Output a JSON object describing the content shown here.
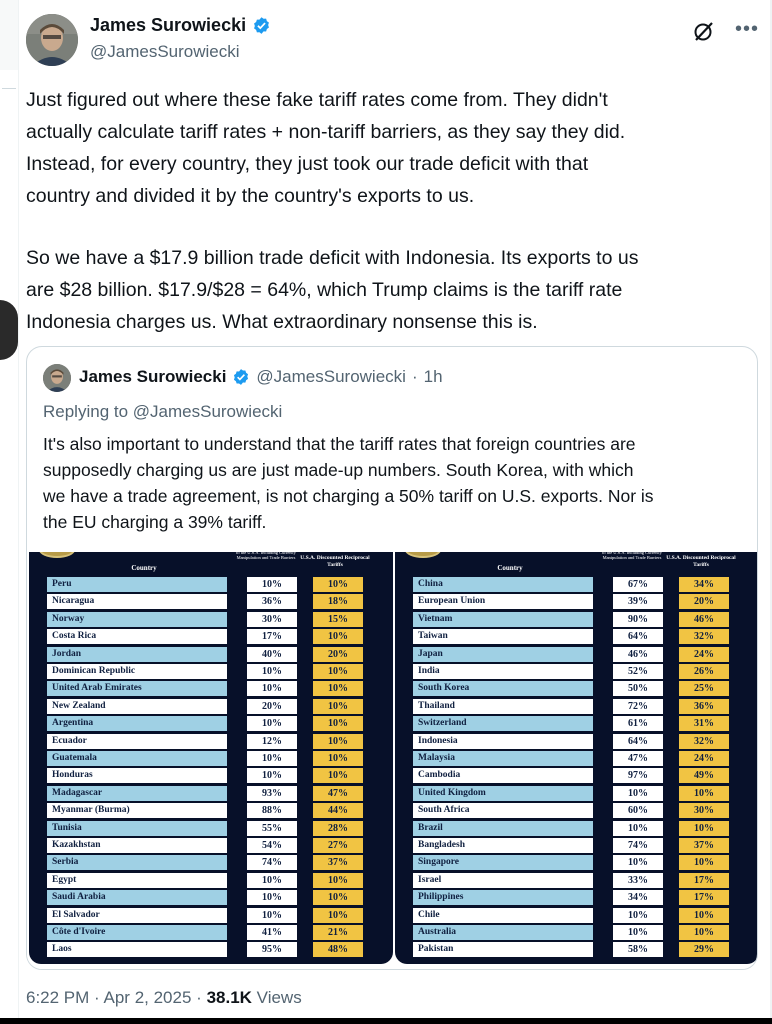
{
  "tweet": {
    "author_name": "James Surowiecki",
    "author_handle": "@JamesSurowiecki",
    "text_lines_p1": [
      "Just figured out where these fake tariff rates come from. They didn't",
      "actually calculate tariff rates + non-tariff barriers, as they say they did.",
      "Instead, for every country, they just took our trade deficit with that",
      "country and divided it by the country's exports to us."
    ],
    "text_lines_p2": [
      "So we have a $17.9 billion trade deficit with Indonesia. Its exports to us",
      "are $28 billion. $17.9/$28 = 64%, which Trump claims is the tariff rate",
      "Indonesia charges us. What extraordinary nonsense this is."
    ],
    "time": "6:22 PM",
    "separator": "·",
    "date": "Apr 2, 2025",
    "views_count": "38.1K",
    "views_label": "Views"
  },
  "quote": {
    "author_name": "James Surowiecki",
    "author_handle": "@JamesSurowiecki",
    "separator": "·",
    "age": "1h",
    "replying_to": "Replying to @JamesSurowiecki",
    "text_lines": [
      "It's also important to understand that the tariff rates that foreign countries are",
      "supposedly charging us are just made-up numbers. South Korea, with which",
      "we have a trade agreement, is not charging a 50% tariff on U.S. exports. Nor is",
      "the EU charging a 39% tariff."
    ]
  },
  "table_headers": {
    "country": "Country",
    "charged": "to the U.S.A. Including Currency Manipulation and Trade Barriers",
    "reciprocal": "U.S.A. Discounted Reciprocal Tariffs"
  },
  "table_left": [
    {
      "country": "Peru",
      "charged": "10%",
      "reciprocal": "10%"
    },
    {
      "country": "Nicaragua",
      "charged": "36%",
      "reciprocal": "18%"
    },
    {
      "country": "Norway",
      "charged": "30%",
      "reciprocal": "15%"
    },
    {
      "country": "Costa Rica",
      "charged": "17%",
      "reciprocal": "10%"
    },
    {
      "country": "Jordan",
      "charged": "40%",
      "reciprocal": "20%"
    },
    {
      "country": "Dominican Republic",
      "charged": "10%",
      "reciprocal": "10%"
    },
    {
      "country": "United Arab Emirates",
      "charged": "10%",
      "reciprocal": "10%"
    },
    {
      "country": "New Zealand",
      "charged": "20%",
      "reciprocal": "10%"
    },
    {
      "country": "Argentina",
      "charged": "10%",
      "reciprocal": "10%"
    },
    {
      "country": "Ecuador",
      "charged": "12%",
      "reciprocal": "10%"
    },
    {
      "country": "Guatemala",
      "charged": "10%",
      "reciprocal": "10%"
    },
    {
      "country": "Honduras",
      "charged": "10%",
      "reciprocal": "10%"
    },
    {
      "country": "Madagascar",
      "charged": "93%",
      "reciprocal": "47%"
    },
    {
      "country": "Myanmar (Burma)",
      "charged": "88%",
      "reciprocal": "44%"
    },
    {
      "country": "Tunisia",
      "charged": "55%",
      "reciprocal": "28%"
    },
    {
      "country": "Kazakhstan",
      "charged": "54%",
      "reciprocal": "27%"
    },
    {
      "country": "Serbia",
      "charged": "74%",
      "reciprocal": "37%"
    },
    {
      "country": "Egypt",
      "charged": "10%",
      "reciprocal": "10%"
    },
    {
      "country": "Saudi Arabia",
      "charged": "10%",
      "reciprocal": "10%"
    },
    {
      "country": "El Salvador",
      "charged": "10%",
      "reciprocal": "10%"
    },
    {
      "country": "Côte d'Ivoire",
      "charged": "41%",
      "reciprocal": "21%"
    },
    {
      "country": "Laos",
      "charged": "95%",
      "reciprocal": "48%"
    }
  ],
  "table_right": [
    {
      "country": "China",
      "charged": "67%",
      "reciprocal": "34%"
    },
    {
      "country": "European Union",
      "charged": "39%",
      "reciprocal": "20%"
    },
    {
      "country": "Vietnam",
      "charged": "90%",
      "reciprocal": "46%"
    },
    {
      "country": "Taiwan",
      "charged": "64%",
      "reciprocal": "32%"
    },
    {
      "country": "Japan",
      "charged": "46%",
      "reciprocal": "24%"
    },
    {
      "country": "India",
      "charged": "52%",
      "reciprocal": "26%"
    },
    {
      "country": "South Korea",
      "charged": "50%",
      "reciprocal": "25%"
    },
    {
      "country": "Thailand",
      "charged": "72%",
      "reciprocal": "36%"
    },
    {
      "country": "Switzerland",
      "charged": "61%",
      "reciprocal": "31%"
    },
    {
      "country": "Indonesia",
      "charged": "64%",
      "reciprocal": "32%"
    },
    {
      "country": "Malaysia",
      "charged": "47%",
      "reciprocal": "24%"
    },
    {
      "country": "Cambodia",
      "charged": "97%",
      "reciprocal": "49%"
    },
    {
      "country": "United Kingdom",
      "charged": "10%",
      "reciprocal": "10%"
    },
    {
      "country": "South Africa",
      "charged": "60%",
      "reciprocal": "30%"
    },
    {
      "country": "Brazil",
      "charged": "10%",
      "reciprocal": "10%"
    },
    {
      "country": "Bangladesh",
      "charged": "74%",
      "reciprocal": "37%"
    },
    {
      "country": "Singapore",
      "charged": "10%",
      "reciprocal": "10%"
    },
    {
      "country": "Israel",
      "charged": "33%",
      "reciprocal": "17%"
    },
    {
      "country": "Philippines",
      "charged": "34%",
      "reciprocal": "17%"
    },
    {
      "country": "Chile",
      "charged": "10%",
      "reciprocal": "10%"
    },
    {
      "country": "Australia",
      "charged": "10%",
      "reciprocal": "10%"
    },
    {
      "country": "Pakistan",
      "charged": "58%",
      "reciprocal": "29%"
    }
  ],
  "icons": {
    "verified": "verified-badge-icon",
    "grok": "grok-icon",
    "more": "more-icon"
  },
  "colors": {
    "verified_blue": "#1d9bf0",
    "secondary_text": "#536471",
    "row_blue": "#9fd0e4",
    "reciprocal_gold": "#f1c443",
    "table_background": "#071029"
  }
}
